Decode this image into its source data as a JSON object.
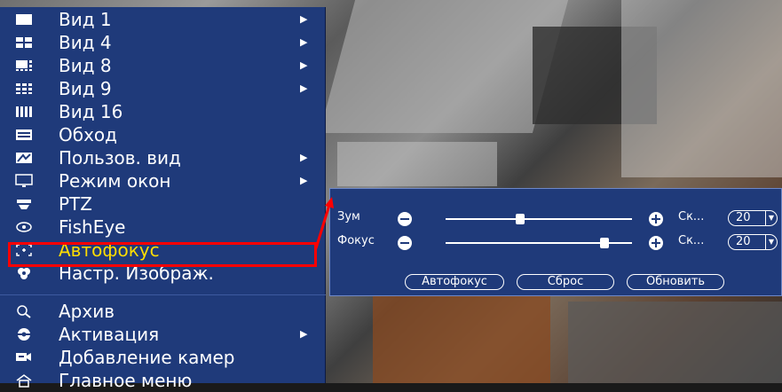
{
  "menu": {
    "items": [
      {
        "label": "Вид 1",
        "icon": "single-view-icon",
        "submenu": true
      },
      {
        "label": "Вид 4",
        "icon": "quad-view-icon",
        "submenu": true
      },
      {
        "label": "Вид 8",
        "icon": "eight-view-icon",
        "submenu": true
      },
      {
        "label": "Вид 9",
        "icon": "nine-view-icon",
        "submenu": true
      },
      {
        "label": "Вид 16",
        "icon": "sixteen-view-icon",
        "submenu": false
      },
      {
        "label": "Обход",
        "icon": "tour-icon",
        "submenu": false
      },
      {
        "label": "Пользов. вид",
        "icon": "custom-view-icon",
        "submenu": true
      },
      {
        "label": "Режим окон",
        "icon": "window-mode-icon",
        "submenu": true
      },
      {
        "label": "PTZ",
        "icon": "ptz-icon",
        "submenu": false
      },
      {
        "label": "FishEye",
        "icon": "fisheye-icon",
        "submenu": false
      },
      {
        "label": "Автофокус",
        "icon": "autofocus-icon",
        "submenu": false,
        "selected": true
      },
      {
        "label": "Настр. Изображ.",
        "icon": "image-settings-icon",
        "submenu": false
      },
      {
        "label": "Архив",
        "icon": "search-icon",
        "submenu": false
      },
      {
        "label": "Активация",
        "icon": "activation-icon",
        "submenu": true
      },
      {
        "label": "Добавление камер",
        "icon": "add-camera-icon",
        "submenu": false
      },
      {
        "label": "Главное меню",
        "icon": "home-icon",
        "submenu": false
      }
    ]
  },
  "autofocus": {
    "zoom": {
      "label": "Зум",
      "step_label": "Ск...",
      "step_value": "20",
      "position": 0.4
    },
    "focus": {
      "label": "Фокус",
      "step_label": "Ск...",
      "step_value": "20",
      "position": 0.85
    },
    "buttons": {
      "autofocus": "Автофокус",
      "reset": "Сброс",
      "refresh": "Обновить"
    }
  },
  "colors": {
    "menu_bg": "#1f3a7a",
    "highlight": "#ff0000",
    "selected_text": "#ffdd00"
  }
}
